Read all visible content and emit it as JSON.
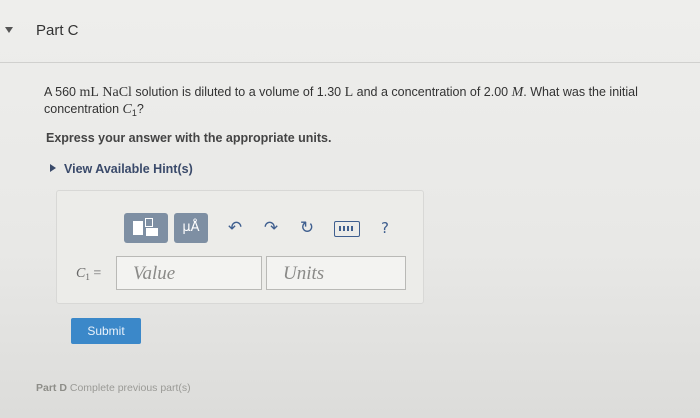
{
  "part": {
    "title": "Part C",
    "toggle_icon": "caret-down-icon"
  },
  "question": {
    "text_1": "A 560 ",
    "unit_ml": "mL",
    "formula": "NaCl",
    "text_2": " solution is diluted to a volume of 1.30 ",
    "unit_l": "L",
    "text_3": " and a concentration of 2.00 ",
    "unit_m": "M",
    "text_4": ". What was the initial concentration ",
    "variable": "C",
    "variable_sub": "1",
    "text_5": "?"
  },
  "instruction": "Express your answer with the appropriate units.",
  "hints": {
    "label": "View Available Hint(s)"
  },
  "toolbar": {
    "templates_icon": "templates-icon",
    "units_label": "μÅ",
    "undo_icon": "undo-icon",
    "redo_icon": "redo-icon",
    "reset_icon": "reset-icon",
    "keyboard_icon": "keyboard-icon",
    "help_label": "?"
  },
  "answer": {
    "variable_label": "C",
    "variable_sub": "1",
    "equals": " =",
    "value_placeholder": "Value",
    "units_placeholder": "Units"
  },
  "submit_label": "Submit",
  "next_part": {
    "label": "Part D",
    "status": "Complete previous part(s)"
  },
  "colors": {
    "accent": "#3b88c9",
    "toolbar_button": "#7e8fa3",
    "icon": "#3f5f8f"
  }
}
